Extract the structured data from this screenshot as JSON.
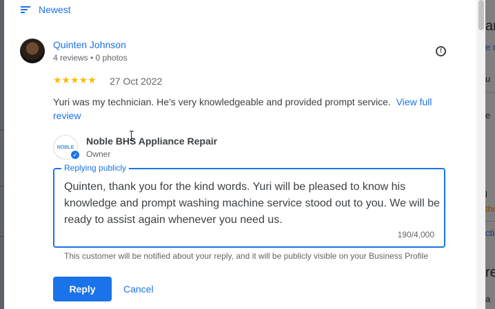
{
  "sort": {
    "label": "Newest"
  },
  "review": {
    "reviewer_name": "Quinten Johnson",
    "reviewer_meta": "4 reviews • 0 photos",
    "stars": "★★★★★",
    "rating": 5,
    "date": "27 Oct 2022",
    "text": "Yuri was my technician. He's very knowledgeable and provided prompt service.",
    "more_link": "View full review"
  },
  "owner": {
    "logo_text": "NOBLE",
    "name": "Noble BHS Appliance Repair",
    "role": "Owner"
  },
  "reply": {
    "label": "Replying publicly",
    "text": "Quinten, thank you for the kind words. Yuri will be pleased to know his knowledge and prompt washing machine service stood out to you. We will be ready to assist again whenever you need us.",
    "char_count": "190/4,000",
    "notice": "This customer will be notified about your reply, and it will be publicly visible on your Business Profile",
    "reply_button": "Reply",
    "cancel_button": "Cancel"
  },
  "background_page": {
    "fragments": [
      "ar",
      "e r",
      "u",
      "e",
      "l",
      "the",
      "ctio",
      "re",
      "a"
    ]
  },
  "colors": {
    "accent": "#1a73e8",
    "star": "#fbbc04"
  },
  "icons": {
    "sort": "sort-icon",
    "flag": "report-flag-icon",
    "verified": "verified-check-icon"
  }
}
